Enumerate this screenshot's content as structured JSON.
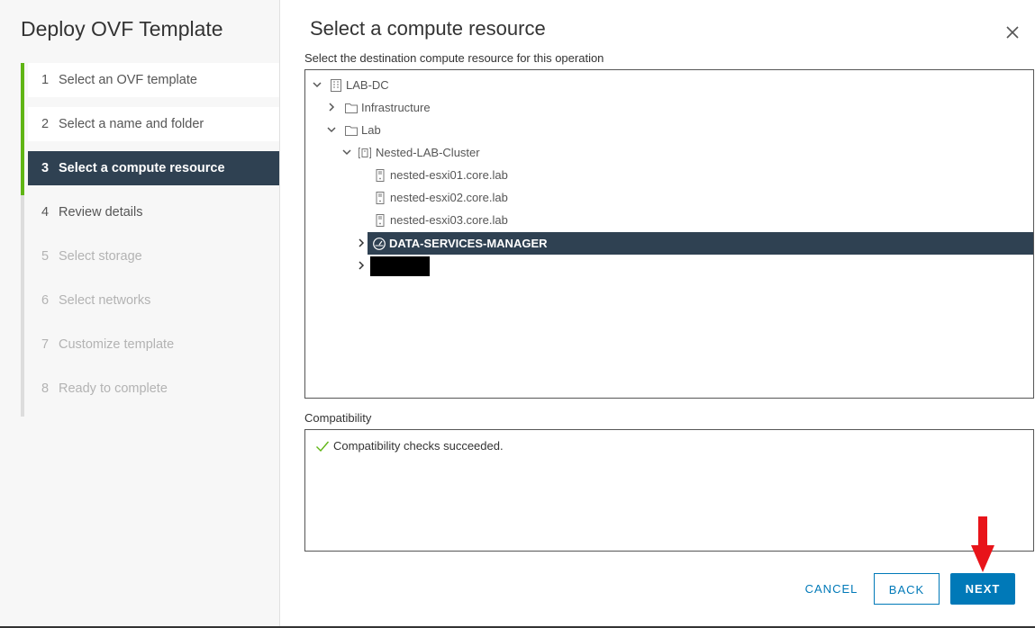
{
  "wizard": {
    "title": "Deploy OVF Template",
    "steps": [
      {
        "num": "1",
        "label": "Select an OVF template",
        "state": "completed"
      },
      {
        "num": "2",
        "label": "Select a name and folder",
        "state": "completed"
      },
      {
        "num": "3",
        "label": "Select a compute resource",
        "state": "active"
      },
      {
        "num": "4",
        "label": "Review details",
        "state": "pending"
      },
      {
        "num": "5",
        "label": "Select storage",
        "state": "disabled"
      },
      {
        "num": "6",
        "label": "Select networks",
        "state": "disabled"
      },
      {
        "num": "7",
        "label": "Customize template",
        "state": "disabled"
      },
      {
        "num": "8",
        "label": "Ready to complete",
        "state": "disabled"
      }
    ]
  },
  "page": {
    "title": "Select a compute resource",
    "instruction": "Select the destination compute resource for this operation"
  },
  "tree": {
    "datacenter": "LAB-DC",
    "folder_infrastructure": "Infrastructure",
    "folder_lab": "Lab",
    "cluster": "Nested-LAB-Cluster",
    "hosts": [
      "nested-esxi01.core.lab",
      "nested-esxi02.core.lab",
      "nested-esxi03.core.lab"
    ],
    "selected_resource_pool": "DATA-SERVICES-MANAGER"
  },
  "compatibility": {
    "label": "Compatibility",
    "message": "Compatibility checks succeeded."
  },
  "buttons": {
    "cancel": "CANCEL",
    "back": "BACK",
    "next": "NEXT"
  },
  "colors": {
    "accent": "#0079b8",
    "active_step_bg": "#2f4152",
    "completed_rail": "#60b515",
    "annotation_arrow": "#e8141a",
    "success_check": "#60b515"
  },
  "icons": {
    "close": "close-icon",
    "datacenter": "datacenter-icon",
    "folder": "folder-icon",
    "cluster": "cluster-icon",
    "host": "host-icon",
    "resource_pool": "resource-pool-icon",
    "check": "check-icon"
  }
}
